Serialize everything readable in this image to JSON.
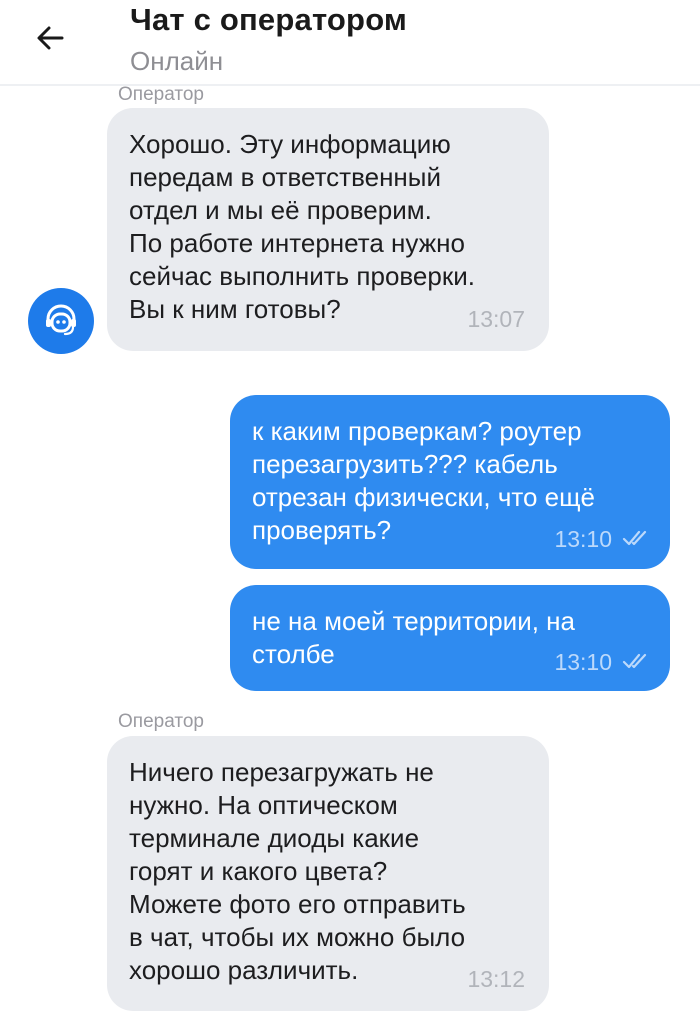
{
  "header": {
    "title": "Чат с оператором",
    "status": "Онлайн"
  },
  "messages": [
    {
      "sender": "Оператор",
      "lines": [
        "Хорошо. Эту информацию",
        "передам в ответственный",
        "отдел и мы её проверим.",
        "По работе интернета нужно",
        "сейчас выполнить проверки.",
        "Вы к ним готовы?"
      ],
      "time": "13:07"
    },
    {
      "lines": [
        "к каким проверкам? роутер",
        "перезагрузить??? кабель",
        "отрезан физически, что ещё",
        "проверять?"
      ],
      "time": "13:10",
      "status": "read"
    },
    {
      "lines": [
        "не на моей территории, на",
        "столбе"
      ],
      "time": "13:10",
      "status": "read"
    },
    {
      "sender": "Оператор",
      "lines": [
        "Ничего перезагружать не",
        "нужно. На оптическом",
        "терминале диоды какие",
        "горят и какого цвета?",
        "Можете фото его отправить",
        "в чат, чтобы их можно было",
        "хорошо различить."
      ],
      "time": "13:12"
    }
  ],
  "icons": {
    "back": "arrow-left-icon",
    "operator_avatar": "operator-headset-icon",
    "read_receipt": "double-check-icon"
  },
  "colors": {
    "incoming_bubble": "#e9ebef",
    "outgoing_bubble": "#2f8bf0",
    "avatar": "#1e7bea"
  }
}
